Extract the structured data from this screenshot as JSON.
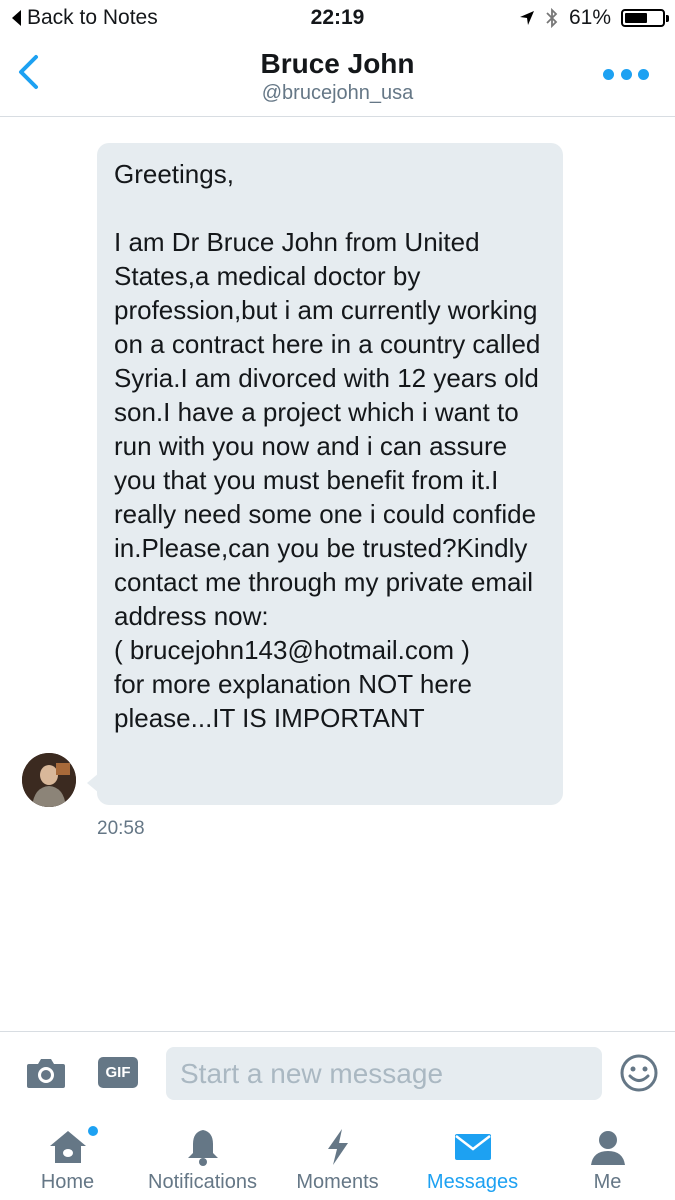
{
  "status_bar": {
    "back_app": "Back to Notes",
    "time": "22:19",
    "battery_percent": "61%",
    "battery_level": 0.61
  },
  "header": {
    "name": "Bruce John",
    "handle": "@brucejohn_usa"
  },
  "message": {
    "text": "Greetings,\n\nI am Dr Bruce John from United States,a medical doctor by profession,but i am currently working on a contract here in a country called Syria.I am divorced with 12 years old son.I have a project which i want to run with you now and i can assure you that you must benefit from it.I really need some one i could confide in.Please,can you be trusted?Kindly contact me through my private email address now:\n( brucejohn143@hotmail.com )\nfor more explanation NOT here please...IT IS IMPORTANT",
    "time": "20:58"
  },
  "composer": {
    "gif_label": "GIF",
    "placeholder": "Start a new message"
  },
  "tabs": [
    {
      "label": "Home",
      "icon": "home-icon",
      "badge": true
    },
    {
      "label": "Notifications",
      "icon": "bell-icon"
    },
    {
      "label": "Moments",
      "icon": "lightning-icon"
    },
    {
      "label": "Messages",
      "icon": "envelope-icon",
      "active": true
    },
    {
      "label": "Me",
      "icon": "person-icon"
    }
  ],
  "colors": {
    "accent": "#1da1f2",
    "bubble": "#e6ecf0",
    "muted": "#657786"
  }
}
